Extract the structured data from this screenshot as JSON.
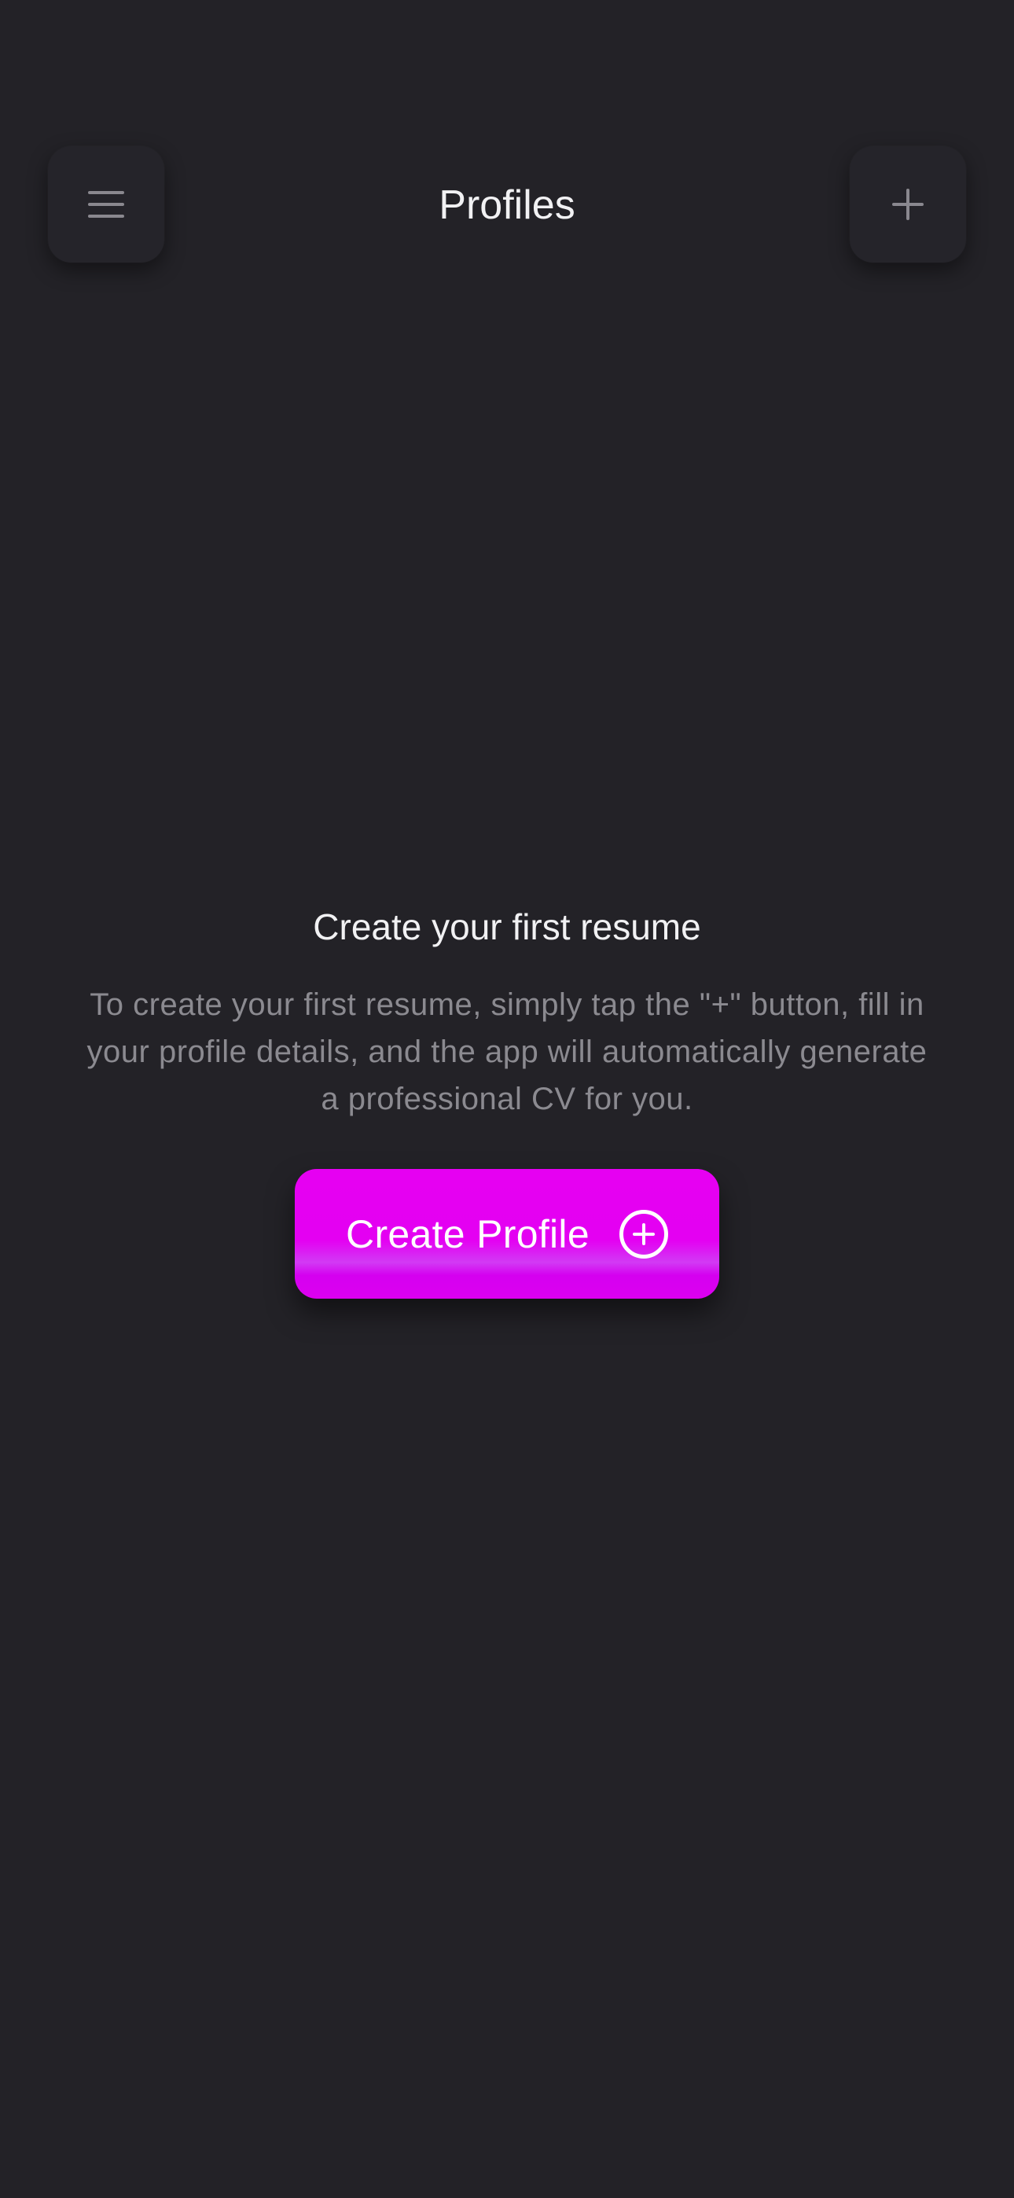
{
  "header": {
    "title": "Profiles",
    "menu_icon": "hamburger-menu-icon",
    "add_icon": "plus-icon"
  },
  "empty_state": {
    "title": "Create your first resume",
    "description": "To create your first resume, simply tap the \"+\" button, fill in your profile details, and the app will automatically generate a professional CV for you.",
    "button_label": "Create Profile",
    "button_icon": "circle-plus-icon"
  },
  "colors": {
    "background": "#232227",
    "accent": "#e600f2",
    "muted_text": "#8b8a90"
  }
}
